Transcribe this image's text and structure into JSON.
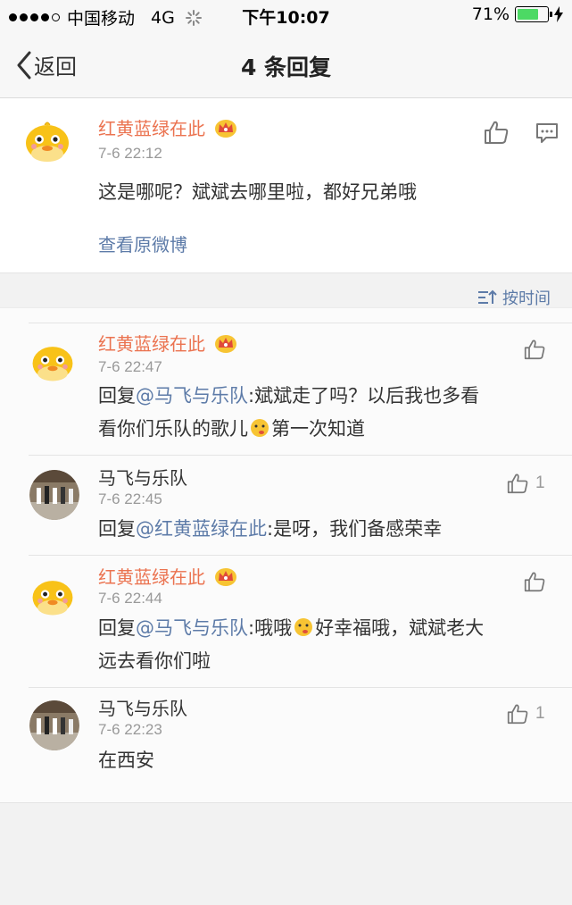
{
  "status_bar": {
    "carrier": "中国移动",
    "network": "4G",
    "time": "下午10:07",
    "battery_percent": "71%",
    "battery_level": 0.71
  },
  "nav": {
    "back_label": "返回",
    "title": "4 条回复"
  },
  "post": {
    "username": "红黄蓝绿在此",
    "time": "7-6 22:12",
    "text": "这是哪呢？斌斌去哪里啦，都好兄弟哦",
    "view_original": "查看原微博"
  },
  "sort_label": "按时间",
  "replies": [
    {
      "username": "红黄蓝绿在此",
      "time": "7-6 22:47",
      "reply_prefix": "回复",
      "mention": "@马飞与乐队",
      "text_line1": ":斌斌走了吗？以后我也多看",
      "text_line2_a": "看你们乐队的歌儿",
      "text_line2_b": "第一次知道",
      "likes": ""
    },
    {
      "username": "马飞与乐队",
      "time": "7-6 22:45",
      "reply_prefix": "回复",
      "mention": "@红黄蓝绿在此",
      "text": ":是呀，我们备感荣幸",
      "likes": "1"
    },
    {
      "username": "红黄蓝绿在此",
      "time": "7-6 22:44",
      "reply_prefix": "回复",
      "mention": "@马飞与乐队",
      "text_line1_a": ":哦哦",
      "text_line1_b": "好幸福哦，斌斌老大",
      "text_line2": "远去看你们啦",
      "likes": ""
    },
    {
      "username": "马飞与乐队",
      "time": "7-6 22:23",
      "text": "在西安",
      "likes": "1"
    }
  ],
  "colors": {
    "vip_name": "#eb7350",
    "link": "#5d7ba8",
    "battery": "#4cd964"
  },
  "icons": [
    "signal-dots-icon",
    "loading-icon",
    "battery-icon",
    "charging-icon",
    "back-chevron-icon",
    "crown-badge-icon",
    "thumbs-up-icon",
    "comment-icon",
    "sort-icon",
    "emoji-icon"
  ]
}
